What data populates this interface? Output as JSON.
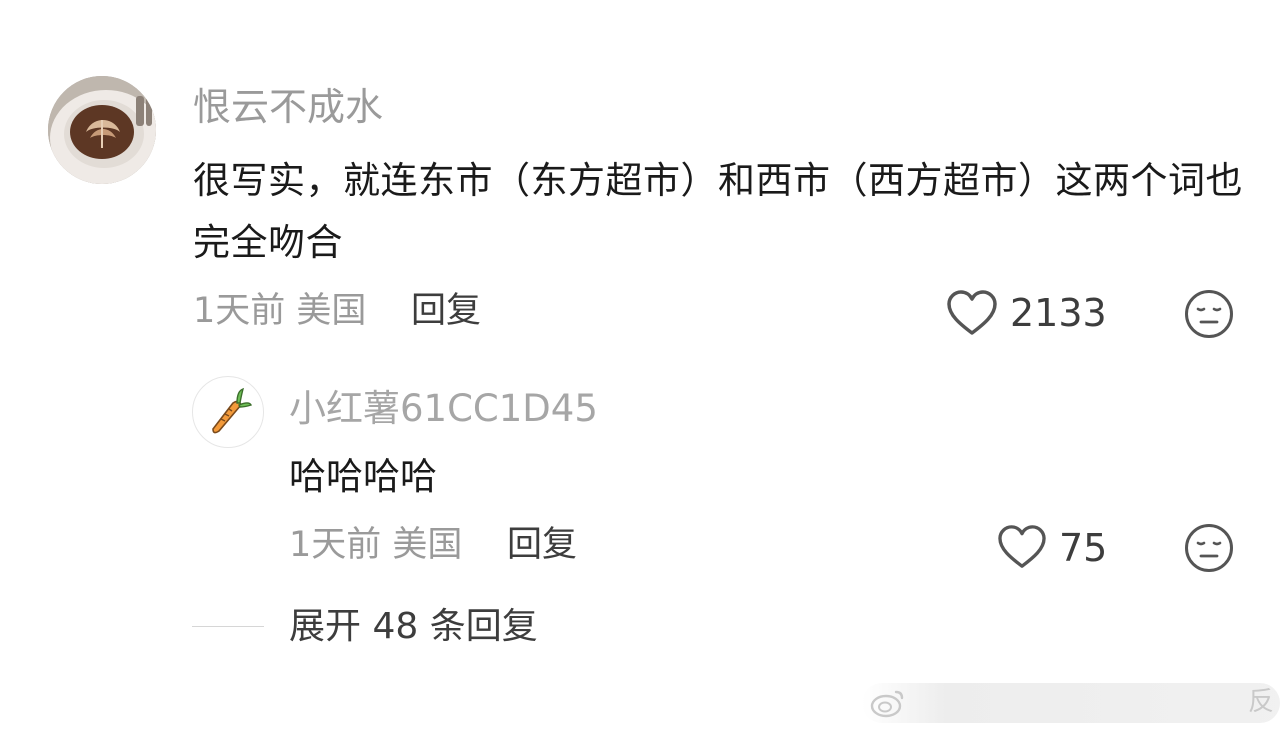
{
  "comment": {
    "username": "恨云不成水",
    "text": "很写实，就连东市（东方超市）和西市（西方超市）这两个词也完全吻合",
    "time_location": "1天前 美国",
    "reply_label": "回复",
    "likes": "2133",
    "avatar_icon": "latte-art-avatar-icon",
    "like_icon": "heart-outline-icon",
    "reaction_icon": "neutral-face-icon"
  },
  "reply": {
    "username": "小红薯61CC1D45",
    "text": "哈哈哈哈",
    "time_location": "1天前 美国",
    "reply_label": "回复",
    "likes": "75",
    "avatar_icon": "carrot-icon",
    "like_icon": "heart-outline-icon",
    "reaction_icon": "neutral-face-icon"
  },
  "expand": {
    "label": "展开 48 条回复"
  },
  "watermark": {
    "icon": "weibo-icon",
    "text": "反"
  },
  "colors": {
    "username": "#9a9a9a",
    "body_text": "#1a1a1a",
    "action_text": "#3d3d3d",
    "icon_stroke": "#555555"
  }
}
